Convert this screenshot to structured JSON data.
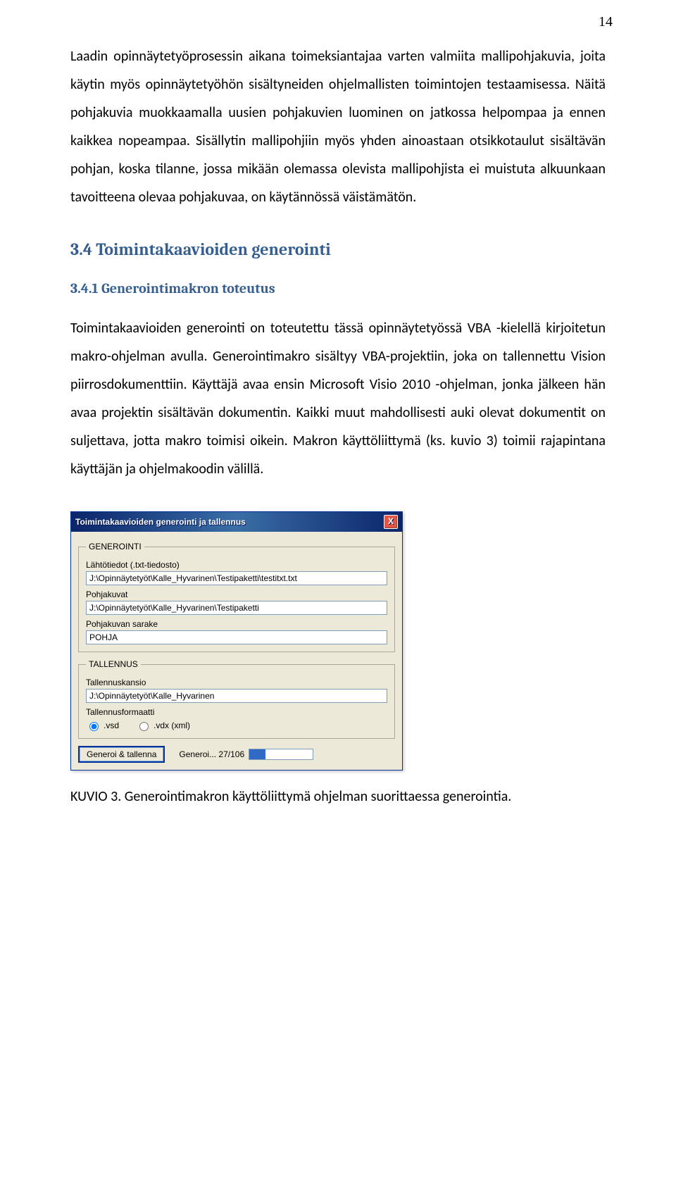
{
  "page_number": "14",
  "paragraph1": "Laadin opinnäytetyöprosessin aikana toimeksiantajaa varten valmiita mallipohjakuvia, joita käytin myös opinnäytetyöhön sisältyneiden ohjelmallisten toimintojen testaamisessa. Näitä pohjakuvia muokkaamalla uusien pohjakuvien luominen on jatkossa helpompaa ja ennen kaikkea nopeampaa. Sisällytin mallipohjiin myös yhden ainoastaan otsikkotaulut sisältävän pohjan, koska tilanne, jossa mikään olemassa olevista mallipohjista ei muistuta alkuunkaan tavoitteena olevaa pohjakuvaa, on käytännössä väistämätön.",
  "heading2": "3.4 Toimintakaavioiden generointi",
  "heading3": "3.4.1 Generointimakron toteutus",
  "paragraph2": "Toimintakaavioiden generointi on toteutettu tässä opinnäytetyössä VBA -kielellä kirjoitetun makro-ohjelman avulla. Generointimakro sisältyy VBA-projektiin, joka on tallennettu Vision piirrosdokumenttiin. Käyttäjä avaa ensin Microsoft Visio 2010 -ohjelman, jonka jälkeen hän avaa projektin sisältävän dokumentin. Kaikki muut mahdollisesti auki olevat dokumentit on suljettava, jotta makro toimisi oikein. Makron käyttöliittymä (ks. kuvio 3)  toimii rajapintana käyttäjän ja ohjelmakoodin välillä.",
  "dialog": {
    "title": "Toimintakaavioiden generointi ja tallennus",
    "close_glyph": "X",
    "group1": {
      "legend": "GENEROINTI",
      "label1": "Lähtötiedot (.txt-tiedosto)",
      "value1": "J:\\Opinnäytetyöt\\Kalle_Hyvarinen\\Testipaketti\\testitxt.txt",
      "label2": "Pohjakuvat",
      "value2": "J:\\Opinnäytetyöt\\Kalle_Hyvarinen\\Testipaketti",
      "label3": "Pohjakuvan sarake",
      "value3": "POHJA"
    },
    "group2": {
      "legend": "TALLENNUS",
      "label1": "Tallennuskansio",
      "value1": "J:\\Opinnäytetyöt\\Kalle_Hyvarinen",
      "label2": "Tallennusformaatti",
      "radio1": ".vsd",
      "radio2": ".vdx (xml)"
    },
    "button_main": "Generoi & tallenna",
    "progress_label": "Generoi... 27/106"
  },
  "caption": "KUVIO 3. Generointimakron käyttöliittymä ohjelman suorittaessa generointia."
}
